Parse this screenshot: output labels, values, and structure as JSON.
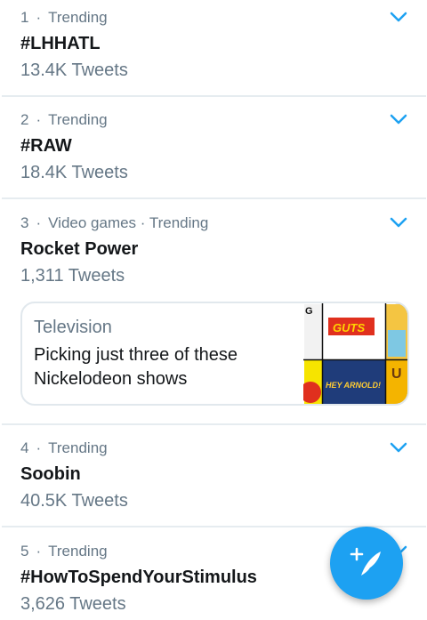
{
  "trends": [
    {
      "rank": "1",
      "category": "Trending",
      "title": "#LHHATL",
      "count": "13.4K Tweets"
    },
    {
      "rank": "2",
      "category": "Trending",
      "title": "#RAW",
      "count": "18.4K Tweets"
    },
    {
      "rank": "3",
      "category": "Video games · Trending",
      "title": "Rocket Power",
      "count": "1,311 Tweets"
    },
    {
      "rank": "4",
      "category": "Trending",
      "title": "Soobin",
      "count": "40.5K Tweets"
    },
    {
      "rank": "5",
      "category": "Trending",
      "title": "#HowToSpendYourStimulus",
      "count": "3,626 Tweets"
    }
  ],
  "card": {
    "category": "Television",
    "headline": "Picking just three of these Nickelodeon shows",
    "thumb_texts": [
      "GUTS",
      "HEY ARNOLD!"
    ]
  },
  "separator": "·",
  "icons": {
    "more": "chevron-down-icon",
    "compose": "compose-tweet-icon"
  },
  "colors": {
    "accent": "#1da1f2",
    "secondary_text": "#657786",
    "primary_text": "#14171a"
  }
}
